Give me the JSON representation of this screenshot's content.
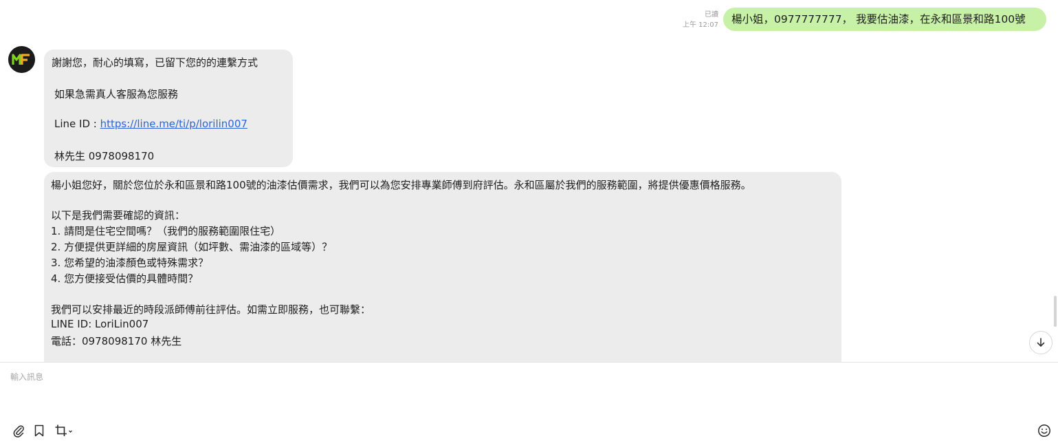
{
  "outgoing": {
    "read_status": "已讀",
    "time": "上午 12:07",
    "text": "楊小姐，0977777777， 我要估油漆，在永和區景和路100號"
  },
  "incoming": {
    "avatar_text": "MF",
    "bubble1": {
      "line1": "謝謝您，耐心的填寫，已留下您的的連繫方式",
      "line2": "如果急需真人客服為您服務",
      "line3_prefix": "Line ID : ",
      "line3_link": "https://line.me/ti/p/lorilin007",
      "line4": "林先生 0978098170"
    },
    "bubble2": {
      "intro": "楊小姐您好，關於您位於永和區景和路100號的油漆估價需求，我們可以為您安排專業師傅到府評估。永和區屬於我們的服務範圍，將提供優惠價格服務。",
      "heading": "以下是我們需要確認的資訊：",
      "q1": "1. 請問是住宅空間嗎？（我們的服務範圍限住宅）",
      "q2": "2. 方便提供更詳細的房屋資訊（如坪數、需油漆的區域等）？",
      "q3": "3. 您希望的油漆顏色或特殊需求？",
      "q4": "4. 您方便接受估價的具體時間？",
      "closing": "我們可以安排最近的時段派師傅前往評估。如需立即服務，也可聯繫：",
      "line_id": "LINE ID: LoriLin007",
      "phone": "電話：0978098170 林先生"
    }
  },
  "composer": {
    "placeholder": "輸入訊息"
  },
  "icons": [
    "paperclip-icon",
    "bookmark-icon",
    "crop-icon",
    "emoji-icon",
    "arrow-down-icon"
  ],
  "colors": {
    "outgoing_bubble": "#c8f1a8",
    "incoming_bubble": "#ececec",
    "link": "#2b63d9"
  }
}
